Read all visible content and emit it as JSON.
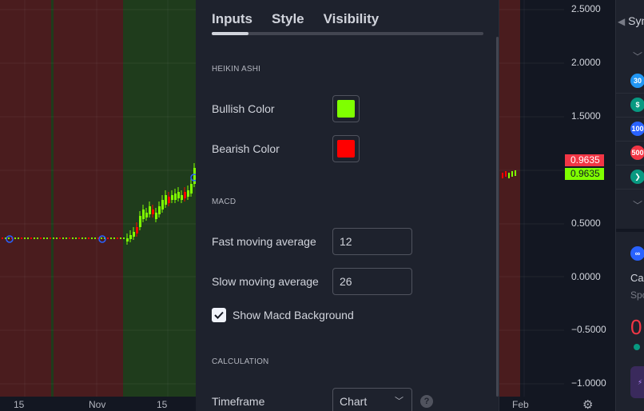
{
  "chart": {
    "price_ticks": [
      "2.5000",
      "2.0000",
      "1.5000",
      "0.5000",
      "0.0000",
      "−0.5000",
      "−1.0000"
    ],
    "time_ticks": [
      "15",
      "Nov",
      "15",
      "Feb"
    ],
    "price_tags": [
      {
        "text": "0.9635",
        "color": "#f23645"
      },
      {
        "text": "0.9635",
        "color": "#7fff00"
      }
    ],
    "background_colors": {
      "bearish": "#4a1c1e",
      "bullish": "#1f3c1c",
      "neutral": "#131722"
    },
    "bull_color": "#7fff00",
    "bear_color": "#ff0000"
  },
  "panel": {
    "tabs": [
      {
        "label": "Inputs",
        "active": true
      },
      {
        "label": "Style",
        "active": false
      },
      {
        "label": "Visibility",
        "active": false
      }
    ],
    "sections": {
      "heikin": "HEIKIN ASHI",
      "macd": "MACD",
      "calculation": "CALCULATION"
    },
    "bullish_label": "Bullish Color",
    "bullish_color": "#7fff00",
    "bearish_label": "Bearish Color",
    "bearish_color": "#ff0000",
    "fast_label": "Fast moving average",
    "fast_value": "12",
    "slow_label": "Slow moving average",
    "slow_value": "26",
    "show_macd_label": "Show Macd Background",
    "show_macd_checked": true,
    "timeframe_label": "Timeframe",
    "timeframe_value": "Chart",
    "help_icon": "?"
  },
  "watchlist": {
    "header": "Syn",
    "items": [
      {
        "badge": "30",
        "color": "#2196f3"
      },
      {
        "badge": "$",
        "color": "#089981"
      },
      {
        "badge": "100",
        "color": "#2962ff"
      },
      {
        "badge": "500",
        "color": "#f23645"
      },
      {
        "badge": "❯",
        "color": "#089981"
      }
    ],
    "detail_title": "Car",
    "detail_sub": "Spo",
    "detail_value": "0"
  }
}
